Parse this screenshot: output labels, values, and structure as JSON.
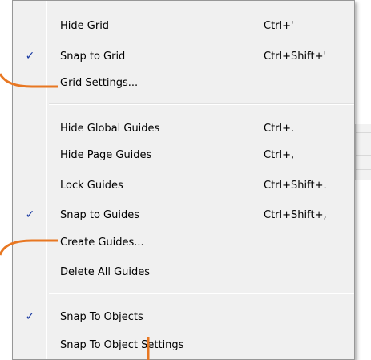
{
  "menu": {
    "items": [
      {
        "label": "Hide Grid",
        "shortcut": "Ctrl+'",
        "checked": false
      },
      {
        "label": "Snap to Grid",
        "shortcut": "Ctrl+Shift+'",
        "checked": true
      },
      {
        "label": "Grid Settings...",
        "shortcut": "",
        "checked": false
      },
      {
        "label": "Hide Global Guides",
        "shortcut": "Ctrl+.",
        "checked": false
      },
      {
        "label": "Hide Page Guides",
        "shortcut": "Ctrl+,",
        "checked": false
      },
      {
        "label": "Lock Guides",
        "shortcut": "Ctrl+Shift+.",
        "checked": false
      },
      {
        "label": "Snap to Guides",
        "shortcut": "Ctrl+Shift+,",
        "checked": true
      },
      {
        "label": "Create Guides...",
        "shortcut": "",
        "checked": false
      },
      {
        "label": "Delete All Guides",
        "shortcut": "",
        "checked": false
      },
      {
        "label": "Snap To Objects",
        "shortcut": "",
        "checked": true
      },
      {
        "label": "Snap To Object Settings",
        "shortcut": "",
        "checked": false
      }
    ]
  },
  "colors": {
    "callout": "#e87722",
    "check": "#1a3ba3",
    "menu_bg": "#f0f0f0"
  },
  "icons": {
    "check": "checkmark-icon"
  }
}
